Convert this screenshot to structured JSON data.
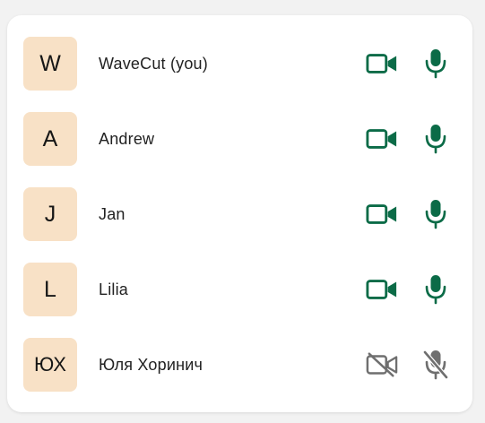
{
  "colors": {
    "active_icon": "#0b6b47",
    "muted_icon": "#6f6f6f",
    "avatar_bg": "#f8e1c6"
  },
  "participants": [
    {
      "initials": "W",
      "name": "WaveCut (you)",
      "camera": "on",
      "mic": "on",
      "camera_icon": "video-camera-icon",
      "mic_icon": "microphone-icon"
    },
    {
      "initials": "A",
      "name": "Andrew",
      "camera": "on",
      "mic": "on",
      "camera_icon": "video-camera-icon",
      "mic_icon": "microphone-icon"
    },
    {
      "initials": "J",
      "name": "Jan",
      "camera": "on",
      "mic": "on",
      "camera_icon": "video-camera-icon",
      "mic_icon": "microphone-icon"
    },
    {
      "initials": "L",
      "name": "Lilia",
      "camera": "on",
      "mic": "on",
      "camera_icon": "video-camera-icon",
      "mic_icon": "microphone-icon"
    },
    {
      "initials": "ЮХ",
      "name": "Юля Хоринич",
      "camera": "off",
      "mic": "off",
      "camera_icon": "video-camera-off-icon",
      "mic_icon": "microphone-off-icon"
    }
  ]
}
